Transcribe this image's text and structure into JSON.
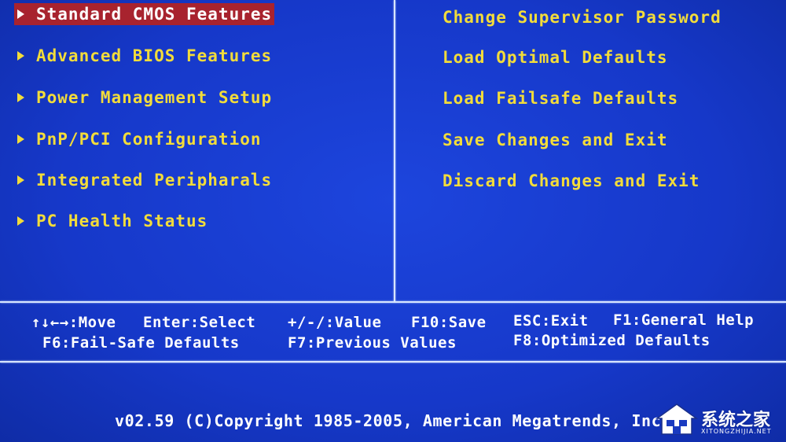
{
  "colors": {
    "background": "#1638c9",
    "menu_text": "#f2dc3a",
    "selected_bg": "#a8232e",
    "selected_text": "#ffffff",
    "help_text": "#ffffff",
    "frame": "#d8e6ff"
  },
  "left_menu": {
    "items": [
      {
        "label": "Standard CMOS Features",
        "selected": true,
        "icon": "triangle-right-icon"
      },
      {
        "label": "Advanced BIOS Features",
        "icon": "triangle-right-icon"
      },
      {
        "label": "Power Management Setup",
        "icon": "triangle-right-icon"
      },
      {
        "label": "PnP/PCI Configuration",
        "icon": "triangle-right-icon"
      },
      {
        "label": "Integrated Peripharals",
        "icon": "triangle-right-icon"
      },
      {
        "label": "PC Health Status",
        "icon": "triangle-right-icon"
      }
    ]
  },
  "right_menu": {
    "items": [
      {
        "label": "Change Supervisor Password"
      },
      {
        "label": "Load Optimal Defaults"
      },
      {
        "label": "Load Failsafe Defaults"
      },
      {
        "label": "Save Changes and Exit"
      },
      {
        "label": "Discard Changes and Exit"
      }
    ]
  },
  "help_bar": {
    "move": "↑↓←→:Move",
    "select": "Enter:Select",
    "value": "+/-/:Value",
    "save": "F10:Save",
    "exit": "ESC:Exit",
    "general_help": "F1:General Help",
    "failsafe": "F6:Fail-Safe Defaults",
    "previous": "F7:Previous Values",
    "optimized": "F8:Optimized Defaults"
  },
  "footer": {
    "copyright": "v02.59 (C)Copyright 1985-2005, American Megatrends, Inc."
  },
  "watermark": {
    "text": "系统之家",
    "sub": "XITONGZHIJIA.NET",
    "icon": "house-logo-icon"
  }
}
